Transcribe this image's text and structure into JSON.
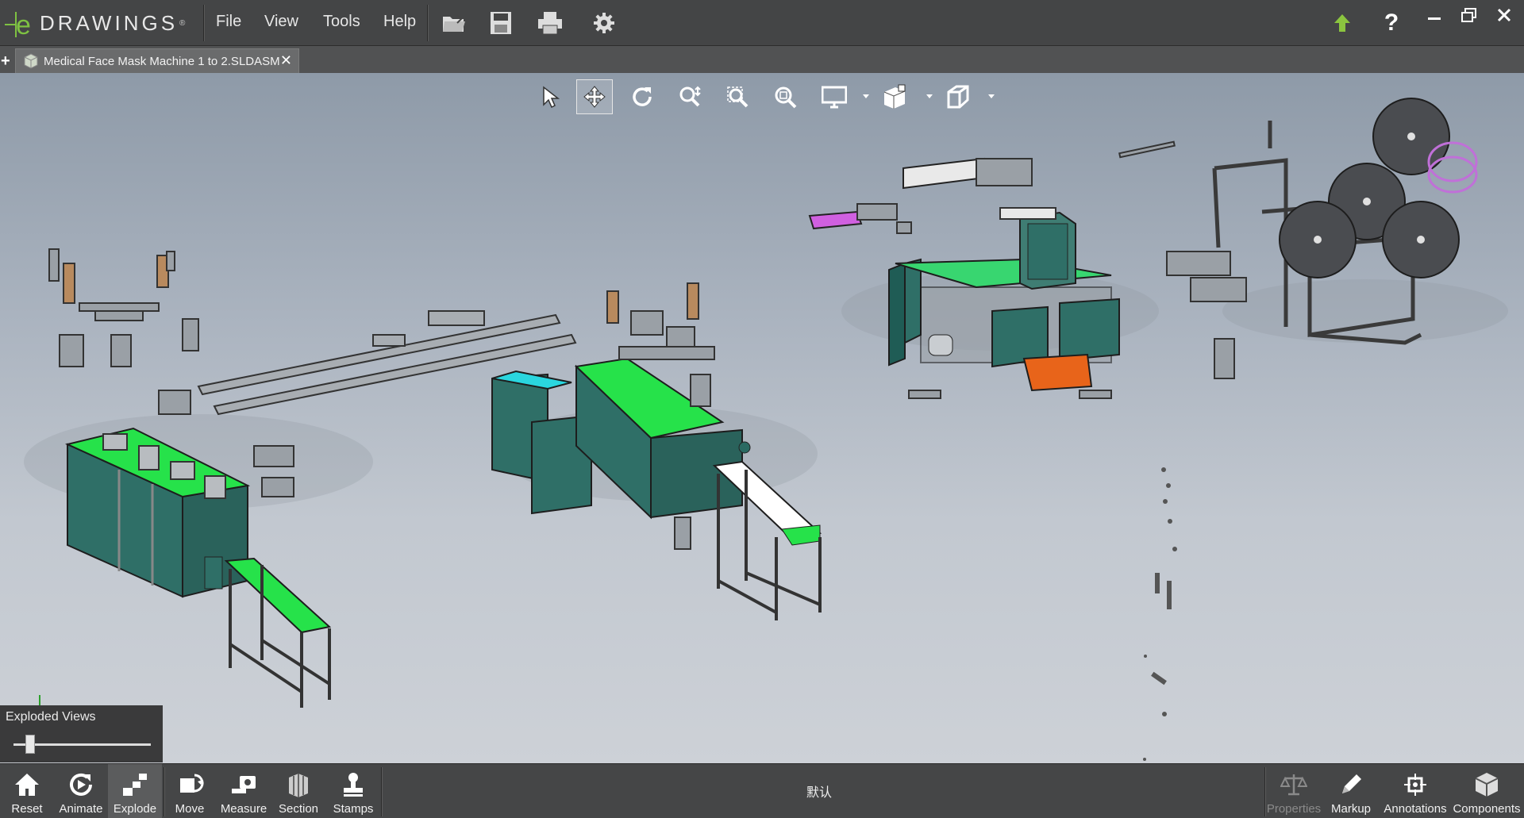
{
  "app": {
    "brand_letter": "e",
    "brand_name": "DRAWINGS",
    "brand_reg": "®"
  },
  "menu": [
    "File",
    "View",
    "Tools",
    "Help"
  ],
  "document": {
    "tab_title": "Medical Face Mask Machine 1 to 2.SLDASM"
  },
  "exploded_views": {
    "title": "Exploded Views",
    "slider_position": 0.12
  },
  "bottom_toolbar": {
    "left": [
      "Reset",
      "Animate",
      "Explode",
      "Move",
      "Measure",
      "Section",
      "Stamps"
    ],
    "right": [
      "Properties",
      "Markup",
      "Annotations",
      "Components"
    ],
    "configuration": "默认"
  },
  "colors": {
    "accent_green": "#7ec142",
    "machine_teal": "#2f6f67",
    "machine_green": "#26e24a",
    "viewport_top": "#8e9aa8",
    "viewport_bottom": "#cdd1d7"
  }
}
